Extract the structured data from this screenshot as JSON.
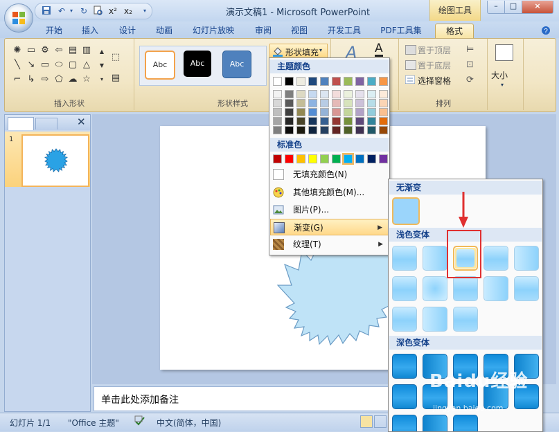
{
  "window": {
    "title": "演示文稿1 - Microsoft PowerPoint",
    "context_tab_group": "绘图工具",
    "controls": [
      "–",
      "□",
      "×"
    ]
  },
  "qat": {
    "icons": [
      "save-icon",
      "undo-icon",
      "redo-icon",
      "print-preview-icon",
      "superscript-icon",
      "subscript-icon"
    ],
    "labels": [
      "x²",
      "x₂"
    ]
  },
  "tabs": [
    {
      "label": "开始"
    },
    {
      "label": "插入"
    },
    {
      "label": "设计"
    },
    {
      "label": "动画"
    },
    {
      "label": "幻灯片放映"
    },
    {
      "label": "审阅"
    },
    {
      "label": "视图"
    },
    {
      "label": "开发工具"
    },
    {
      "label": "PDF工具集"
    },
    {
      "label": "格式",
      "active": true
    }
  ],
  "ribbon": {
    "insert_shapes": {
      "label": "插入形状"
    },
    "shape_styles": {
      "label": "形状样式",
      "style_sample": "Abc",
      "fill_button": "形状填充"
    },
    "arrange": {
      "label": "排列",
      "bring_front": "置于顶层",
      "send_back": "置于底层",
      "selection_pane": "选择窗格"
    },
    "size": {
      "label": "大小"
    }
  },
  "fill_menu": {
    "theme_colors_header": "主题颜色",
    "standard_colors_header": "标准色",
    "theme_top_row": [
      "#ffffff",
      "#000000",
      "#eeece1",
      "#1f497d",
      "#4f81bd",
      "#c0504d",
      "#9bbb59",
      "#8064a2",
      "#4bacc6",
      "#f79646"
    ],
    "theme_shades": [
      [
        "#f2f2f2",
        "#7f7f7f",
        "#ddd9c3",
        "#c6d9f0",
        "#dbe5f1",
        "#f2dcdb",
        "#ebf1dd",
        "#e5e0ec",
        "#dbeef3",
        "#fdeada"
      ],
      [
        "#d8d8d8",
        "#595959",
        "#c4bd97",
        "#8db3e2",
        "#b8cce4",
        "#e5b9b7",
        "#d7e3bc",
        "#ccc1d9",
        "#b7dde8",
        "#fbd5b5"
      ],
      [
        "#bfbfbf",
        "#3f3f3f",
        "#938953",
        "#548dd4",
        "#95b3d7",
        "#d99694",
        "#c3d69b",
        "#b2a2c7",
        "#92cddc",
        "#fac08f"
      ],
      [
        "#a5a5a5",
        "#262626",
        "#494429",
        "#17365d",
        "#366092",
        "#953734",
        "#76923c",
        "#5f497a",
        "#31859b",
        "#e36c09"
      ],
      [
        "#7f7f7f",
        "#0c0c0c",
        "#1d1b10",
        "#0f243e",
        "#244061",
        "#632423",
        "#4f6128",
        "#3f3151",
        "#205867",
        "#974806"
      ]
    ],
    "standard_colors": [
      "#c00000",
      "#ff0000",
      "#ffc000",
      "#ffff00",
      "#92d050",
      "#00b050",
      "#00b0f0",
      "#0070c0",
      "#002060",
      "#7030a0"
    ],
    "items": [
      {
        "label": "无填充颜色(N)",
        "icon": "no-fill-icon"
      },
      {
        "label": "其他填充颜色(M)...",
        "icon": "color-palette-icon"
      },
      {
        "label": "图片(P)...",
        "icon": "picture-icon"
      },
      {
        "label": "渐变(G)",
        "icon": "gradient-icon",
        "highlighted": true,
        "submenu": true
      },
      {
        "label": "纹理(T)",
        "icon": "texture-icon",
        "submenu": true
      }
    ]
  },
  "gradient_menu": {
    "no_gradient_header": "无渐变",
    "light_variants_header": "浅色变体",
    "dark_variants_header": "深色变体"
  },
  "slides_pane": {
    "slide_number": "1"
  },
  "notes": {
    "placeholder": "单击此处添加备注"
  },
  "status": {
    "slide": "幻灯片 1/1",
    "theme": "\"Office 主题\"",
    "language": "中文(简体，中国)"
  },
  "watermark": {
    "text": "Baidu经验",
    "sub": "jingyan.baidu.com"
  }
}
